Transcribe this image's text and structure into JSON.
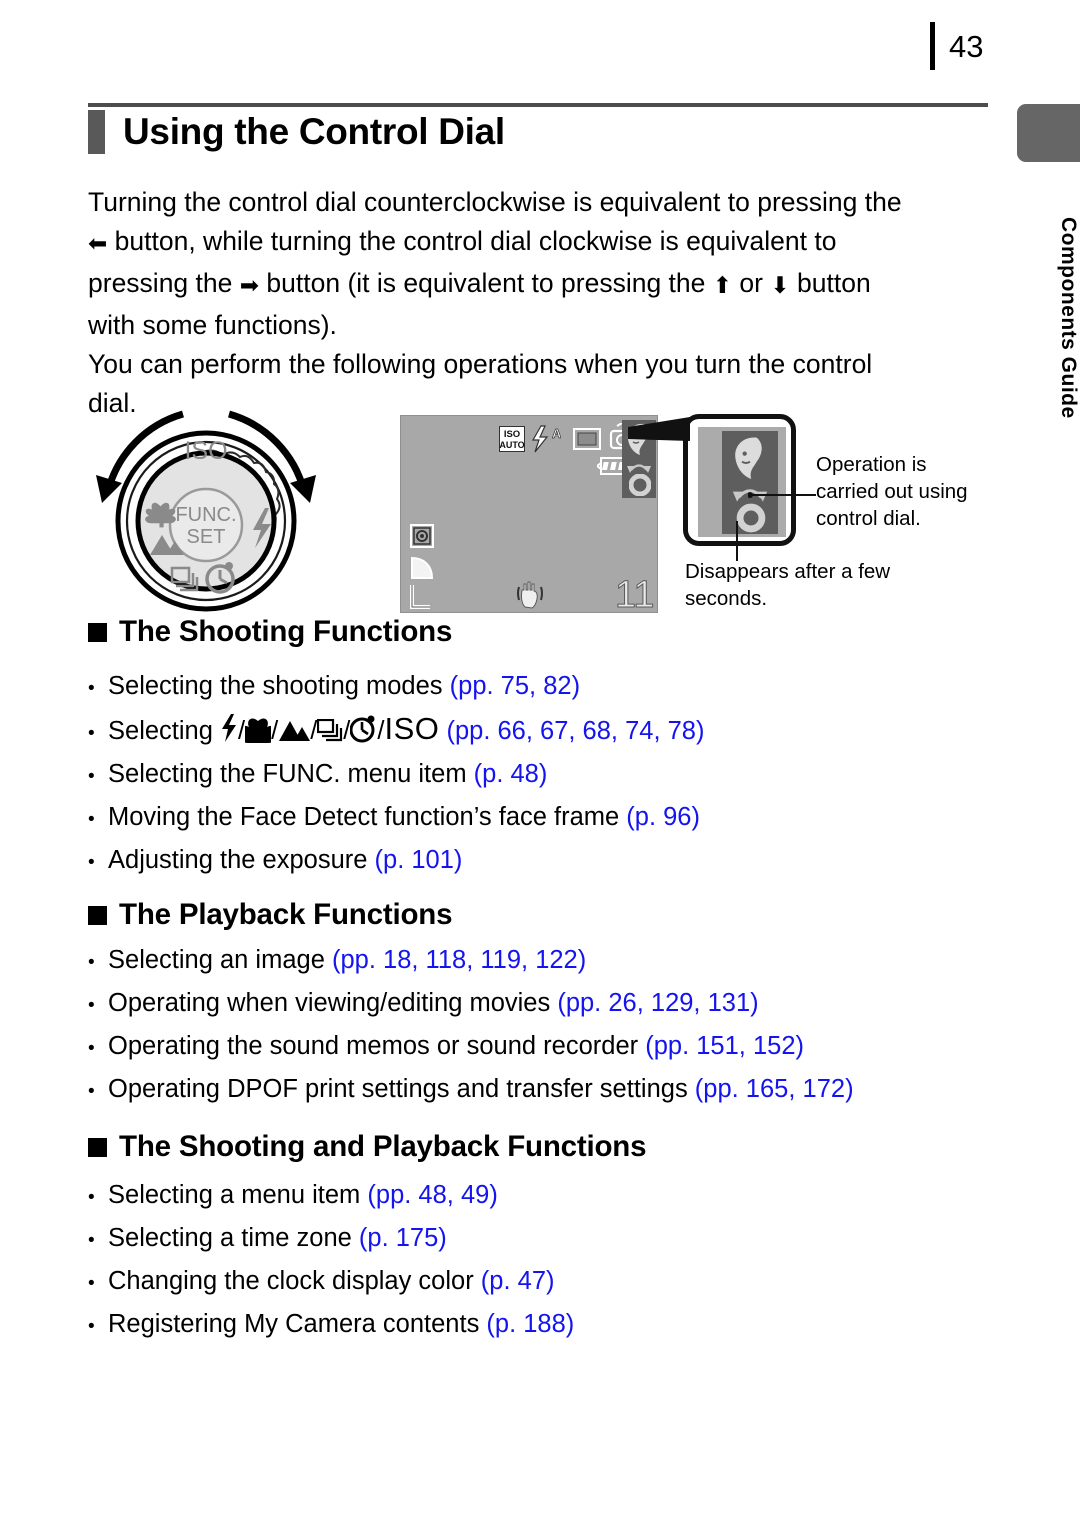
{
  "page": {
    "number": "43"
  },
  "sidebar": {
    "tab_label": "Components Guide"
  },
  "header": {
    "title": "Using the Control Dial"
  },
  "intro": {
    "line1": "Turning the control dial counterclockwise is equivalent to pressing the",
    "line2_a": "button, while turning the control dial clockwise is equivalent to",
    "line3_a": "pressing the",
    "line3_b": "button (it is equivalent to pressing the",
    "line3_c": "or",
    "line3_d": "button",
    "line4": "with some functions).",
    "line5": "You can perform the following operations when you turn the control",
    "line6": "dial.",
    "arrow_left": "left-arrow-glyph",
    "arrow_right": "right-arrow-glyph",
    "arrow_up": "up-arrow-glyph",
    "arrow_down": "down-arrow-glyph"
  },
  "figure": {
    "dial": {
      "iso_label": "ISO",
      "func_label": "FUNC.",
      "set_label": "SET",
      "icons": [
        "macro-icon",
        "landscape-icon",
        "flash-icon",
        "continuous-icon",
        "self-timer-icon"
      ],
      "arrows": [
        "counterclockwise-arrow",
        "clockwise-arrow"
      ]
    },
    "lcd": {
      "iso_text": "ISO",
      "auto_text": "AUTO",
      "flash_auto": "flash-auto-icon",
      "af_frame": "af-frame-icon",
      "shooting_mode": "camera-mode-icon",
      "battery": "battery-icon",
      "metering": "metering-icon",
      "compression": "compression-fine-icon",
      "resolution": "L",
      "shake_warning": "camera-shake-icon",
      "shots_remaining": "11",
      "panel_icons": [
        "face-portrait-icon",
        "rotate-dial-icon",
        "dial-ring-icon"
      ]
    },
    "callouts": {
      "operation_line1": "Operation is",
      "operation_line2": "carried out using",
      "operation_line3": "control dial.",
      "disappears_line1": "Disappears after a few",
      "disappears_line2": "seconds."
    }
  },
  "sections": [
    {
      "heading": "The Shooting Functions",
      "items": [
        {
          "text": "Selecting the shooting modes ",
          "ref": "(pp. 75, 82)"
        },
        {
          "text": "Selecting ",
          "icons": true,
          "ref": "(pp. 66, 67, 68, 74, 78)"
        },
        {
          "text": "Selecting the FUNC. menu item ",
          "ref": "(p. 48)"
        },
        {
          "text": "Moving the Face Detect function’s face frame ",
          "ref": "(p. 96)"
        },
        {
          "text": "Adjusting the exposure ",
          "ref": "(p. 101)"
        }
      ]
    },
    {
      "heading": "The Playback Functions",
      "items": [
        {
          "text": "Selecting an image ",
          "ref": "(pp. 18,  118,  119, 122)"
        },
        {
          "text": "Operating when viewing/editing movies ",
          "ref": "(pp. 26, 129, 131)"
        },
        {
          "text": "Operating the sound memos or sound recorder ",
          "ref": "(pp. 151, 152)"
        },
        {
          "text": "Operating DPOF print settings and transfer settings ",
          "ref": "(pp. 165, 172)"
        }
      ]
    },
    {
      "heading": "The Shooting and Playback Functions",
      "items": [
        {
          "text": "Selecting a menu item ",
          "ref": "(pp. 48, 49)"
        },
        {
          "text": "Selecting a time zone ",
          "ref": "(p. 175)"
        },
        {
          "text": "Changing the clock display color ",
          "ref": "(p. 47)"
        },
        {
          "text": "Registering My Camera contents ",
          "ref": "(p. 188)"
        }
      ]
    }
  ],
  "colors": {
    "reference_blue": "#1414ee",
    "tab_gray": "#666666",
    "lcd_gray": "#a8a8a8"
  }
}
